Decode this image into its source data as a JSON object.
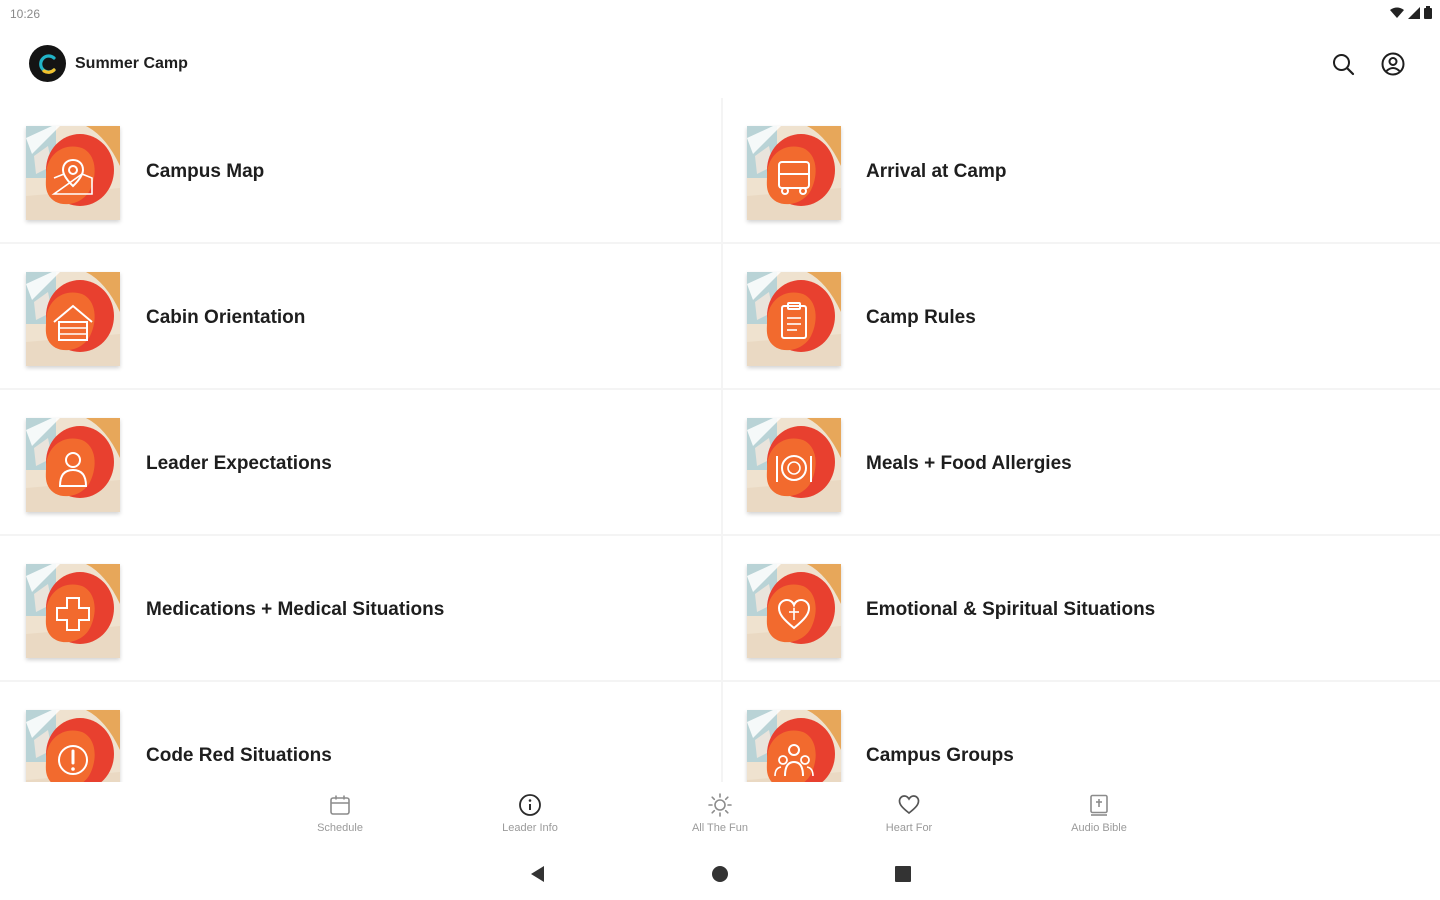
{
  "status_bar": {
    "time": "10:26"
  },
  "app_bar": {
    "title": "Summer Camp",
    "logo_letter": "C"
  },
  "tiles": [
    {
      "label": "Campus Map",
      "icon": "map-pin-icon"
    },
    {
      "label": "Arrival at Camp",
      "icon": "bus-icon"
    },
    {
      "label": "Cabin Orientation",
      "icon": "cabin-icon"
    },
    {
      "label": "Camp Rules",
      "icon": "clipboard-icon"
    },
    {
      "label": "Leader Expectations",
      "icon": "person-icon"
    },
    {
      "label": "Meals + Food Allergies",
      "icon": "plate-icon"
    },
    {
      "label": "Medications + Medical Situations",
      "icon": "medical-cross-icon"
    },
    {
      "label": "Emotional & Spiritual Situations",
      "icon": "heart-icon"
    },
    {
      "label": "Code Red Situations",
      "icon": "alert-icon"
    },
    {
      "label": "Campus Groups",
      "icon": "group-icon"
    }
  ],
  "bottom_nav": [
    {
      "label": "Schedule",
      "icon": "calendar-icon"
    },
    {
      "label": "Leader Info",
      "icon": "info-icon"
    },
    {
      "label": "All The Fun",
      "icon": "sun-icon"
    },
    {
      "label": "Heart For",
      "icon": "heart-outline-icon"
    },
    {
      "label": "Audio Bible",
      "icon": "bible-icon"
    }
  ],
  "colors": {
    "accent_orange": "#f26a2e",
    "accent_red": "#e8402f",
    "logo_ring": "#21b4c8"
  }
}
